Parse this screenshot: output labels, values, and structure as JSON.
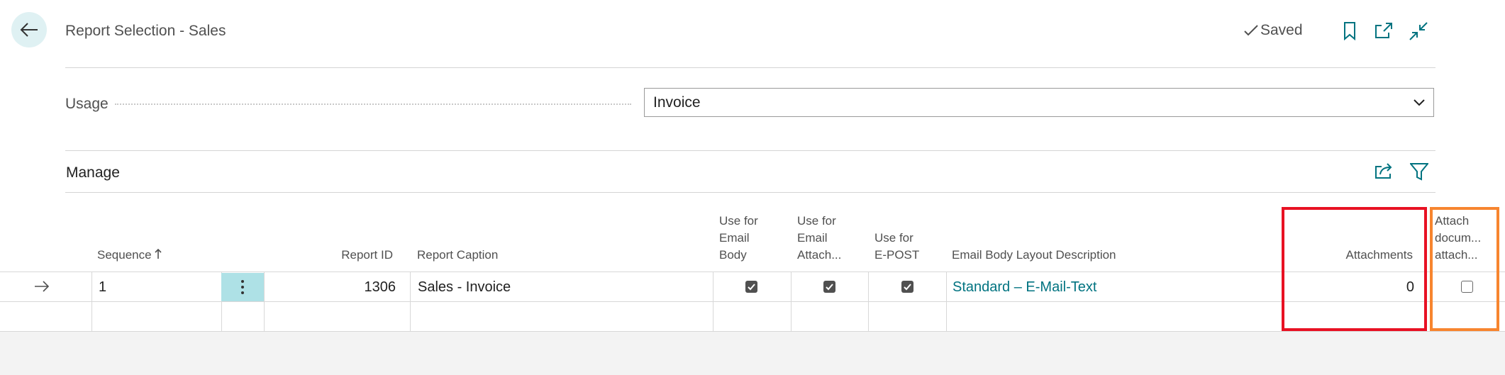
{
  "header": {
    "title": "Report Selection - Sales",
    "saved_label": "Saved",
    "icons": [
      "back-arrow-icon",
      "bookmark-icon",
      "open-in-new-window-icon",
      "collapse-icon"
    ]
  },
  "usage": {
    "label": "Usage",
    "selected": "Invoice"
  },
  "manage": {
    "label": "Manage",
    "icons": [
      "share-icon",
      "filter-icon"
    ]
  },
  "table": {
    "columns": {
      "sequence": "Sequence",
      "report_id": "Report ID",
      "report_caption": "Report Caption",
      "use_email_body": [
        "Use for",
        "Email",
        "Body"
      ],
      "use_email_attach": [
        "Use for",
        "Email",
        "Attach..."
      ],
      "use_epost": [
        "Use for",
        "E-POST"
      ],
      "email_body_layout": "Email Body Layout Description",
      "attachments": "Attachments",
      "attach_documents": [
        "Attach",
        "docum...",
        "attach..."
      ]
    },
    "rows": [
      {
        "sequence": "1",
        "report_id": "1306",
        "report_caption": "Sales - Invoice",
        "use_email_body": true,
        "use_email_attach": true,
        "use_epost": true,
        "email_body_layout": "Standard – E-Mail-Text",
        "attachments": "0",
        "attach_documents": false
      }
    ]
  },
  "colors": {
    "accent": "#007380",
    "highlight_red": "#e81123",
    "highlight_orange": "#f7852f",
    "selected_cell": "#aee1e6"
  }
}
